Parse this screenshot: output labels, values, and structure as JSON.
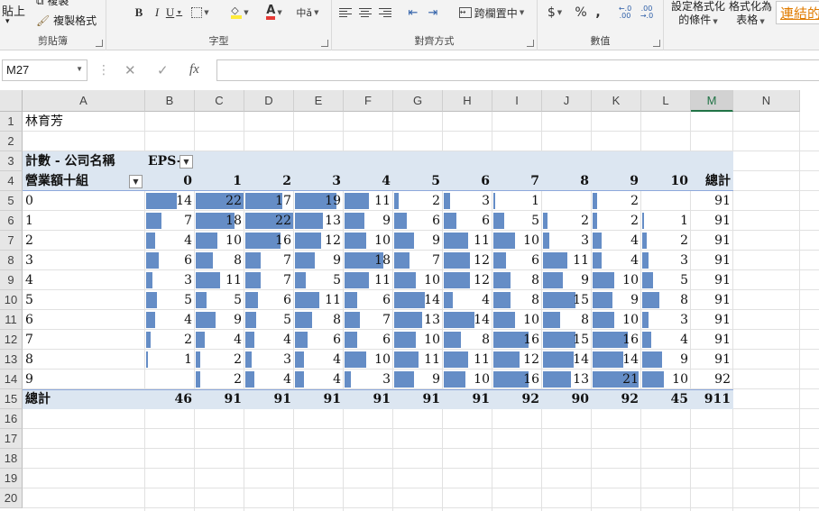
{
  "ribbon": {
    "clipboard": {
      "paste": "貼上",
      "copy": "複製",
      "format_painter": "複製格式",
      "label": "剪貼簿"
    },
    "font": {
      "bold": "B",
      "italic": "I",
      "underline": "U",
      "font_color_glyph": "A",
      "label": "字型"
    },
    "alignment": {
      "merge_center": "跨欄置中",
      "label": "對齊方式"
    },
    "number": {
      "currency": "$",
      "percent": "%",
      "comma": ",",
      "inc_decimal": "←.0 .00",
      "dec_decimal": ".00 →.0",
      "label": "數值"
    },
    "styles": {
      "conditional_l1": "設定格式化",
      "conditional_l2": "的條件",
      "table_l1": "格式化為",
      "table_l2": "表格",
      "cell_style": "連結的"
    }
  },
  "formula_bar": {
    "name_box": "M27",
    "fx": "fx",
    "cancel": "✕",
    "enter": "✓",
    "value": ""
  },
  "columns": [
    "A",
    "B",
    "C",
    "D",
    "E",
    "F",
    "G",
    "H",
    "I",
    "J",
    "K",
    "L",
    "M",
    "N"
  ],
  "selected_column": "M",
  "rows": [
    "1",
    "2",
    "3",
    "4",
    "5",
    "6",
    "7",
    "8",
    "9",
    "10",
    "11",
    "12",
    "13",
    "14",
    "15",
    "16",
    "17",
    "18",
    "19",
    "20"
  ],
  "sheet": {
    "a1": "林育芳",
    "pivot_title": "計數 - 公司名稱",
    "col_field": "EPS-",
    "row_field": "營業額十組",
    "col_headers": [
      "0",
      "1",
      "2",
      "3",
      "4",
      "5",
      "6",
      "7",
      "8",
      "9",
      "10",
      "總計"
    ],
    "row_labels": [
      "0",
      "1",
      "2",
      "3",
      "4",
      "5",
      "6",
      "7",
      "8",
      "9"
    ],
    "values": [
      [
        "14",
        "22",
        "17",
        "19",
        "11",
        "2",
        "3",
        "1",
        "",
        "2",
        "",
        "91"
      ],
      [
        "7",
        "18",
        "22",
        "13",
        "9",
        "6",
        "6",
        "5",
        "2",
        "2",
        "1",
        "91"
      ],
      [
        "4",
        "10",
        "16",
        "12",
        "10",
        "9",
        "11",
        "10",
        "3",
        "4",
        "2",
        "91"
      ],
      [
        "6",
        "8",
        "7",
        "9",
        "18",
        "7",
        "12",
        "6",
        "11",
        "4",
        "3",
        "91"
      ],
      [
        "3",
        "11",
        "7",
        "5",
        "11",
        "10",
        "12",
        "8",
        "9",
        "10",
        "5",
        "91"
      ],
      [
        "5",
        "5",
        "6",
        "11",
        "6",
        "14",
        "4",
        "8",
        "15",
        "9",
        "8",
        "91"
      ],
      [
        "4",
        "9",
        "5",
        "8",
        "7",
        "13",
        "14",
        "10",
        "8",
        "10",
        "3",
        "91"
      ],
      [
        "2",
        "4",
        "4",
        "6",
        "6",
        "10",
        "8",
        "16",
        "15",
        "16",
        "4",
        "91"
      ],
      [
        "1",
        "2",
        "3",
        "4",
        "10",
        "11",
        "11",
        "12",
        "14",
        "14",
        "9",
        "91"
      ],
      [
        "",
        "2",
        "4",
        "4",
        "3",
        "9",
        "10",
        "16",
        "13",
        "21",
        "10",
        "92"
      ]
    ],
    "total_label": "總計",
    "totals": [
      "46",
      "91",
      "91",
      "91",
      "91",
      "91",
      "91",
      "92",
      "90",
      "92",
      "45",
      "911"
    ],
    "databar_max": 22,
    "databar_color": "#658dc6",
    "band_color": "#dce6f1"
  }
}
